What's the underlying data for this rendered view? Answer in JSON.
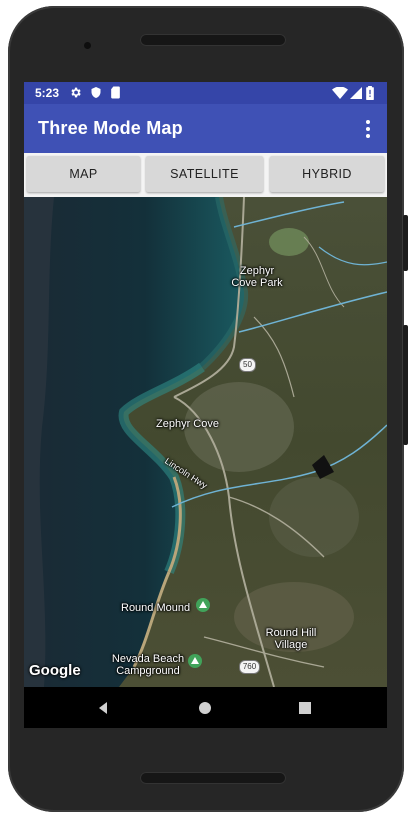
{
  "status_bar": {
    "time": "5:23",
    "left_icons": [
      "gear-icon",
      "shield-icon",
      "sd-card-icon"
    ],
    "right_icons": [
      "wifi-icon",
      "signal-icon",
      "battery-icon"
    ]
  },
  "app_bar": {
    "title": "Three Mode Map",
    "menu_icon": "more-vert-icon"
  },
  "map_type_buttons": [
    "MAP",
    "SATELLITE",
    "HYBRID"
  ],
  "map": {
    "view": "hybrid",
    "labels": {
      "zephyr_cove_park": "Zephyr\nCove Park",
      "zephyr_cove": "Zephyr Cove",
      "lincoln_hwy": "Lincoln Hwy",
      "round_mound": "Round Mound",
      "round_hill_village": "Round Hill\nVillage",
      "nevada_beach": "Nevada Beach\nCampground"
    },
    "route_shields": [
      "50",
      "760"
    ],
    "attribution": "Google"
  },
  "nav_bar": {
    "buttons": [
      "back-icon",
      "home-icon",
      "recents-icon"
    ]
  }
}
